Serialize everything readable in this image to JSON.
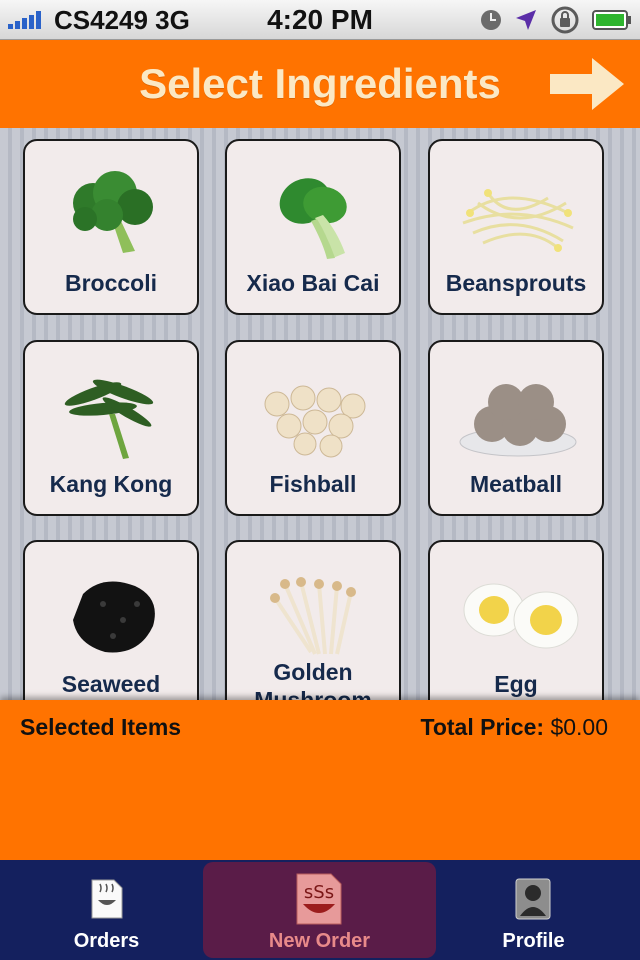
{
  "status": {
    "carrier": "CS4249 3G",
    "time": "4:20 PM"
  },
  "header": {
    "title": "Select Ingredients",
    "next_icon": "right-arrow-icon"
  },
  "ingredients": [
    {
      "name": "Broccoli",
      "icon": "broccoli-image"
    },
    {
      "name": "Xiao Bai Cai",
      "icon": "bok-choy-image"
    },
    {
      "name": "Beansprouts",
      "icon": "beansprouts-image"
    },
    {
      "name": "Kang Kong",
      "icon": "kang-kong-image"
    },
    {
      "name": "Fishball",
      "icon": "fishball-image"
    },
    {
      "name": "Meatball",
      "icon": "meatball-image"
    },
    {
      "name": "Seaweed",
      "icon": "seaweed-image"
    },
    {
      "name": "Golden Mushroom",
      "icon": "golden-mushroom-image"
    },
    {
      "name": "Egg",
      "icon": "egg-image"
    }
  ],
  "selection": {
    "label": "Selected Items",
    "total_label": "Total Price:",
    "total_value": "$0.00"
  },
  "tabs": [
    {
      "label": "Orders",
      "icon": "orders-icon"
    },
    {
      "label": "New Order",
      "icon": "new-order-icon",
      "active": true
    },
    {
      "label": "Profile",
      "icon": "profile-icon"
    }
  ],
  "colors": {
    "accent": "#ff7300",
    "title_text": "#fbe8c4",
    "tab_bar": "#14205e",
    "tab_active": "#5a1c48"
  }
}
